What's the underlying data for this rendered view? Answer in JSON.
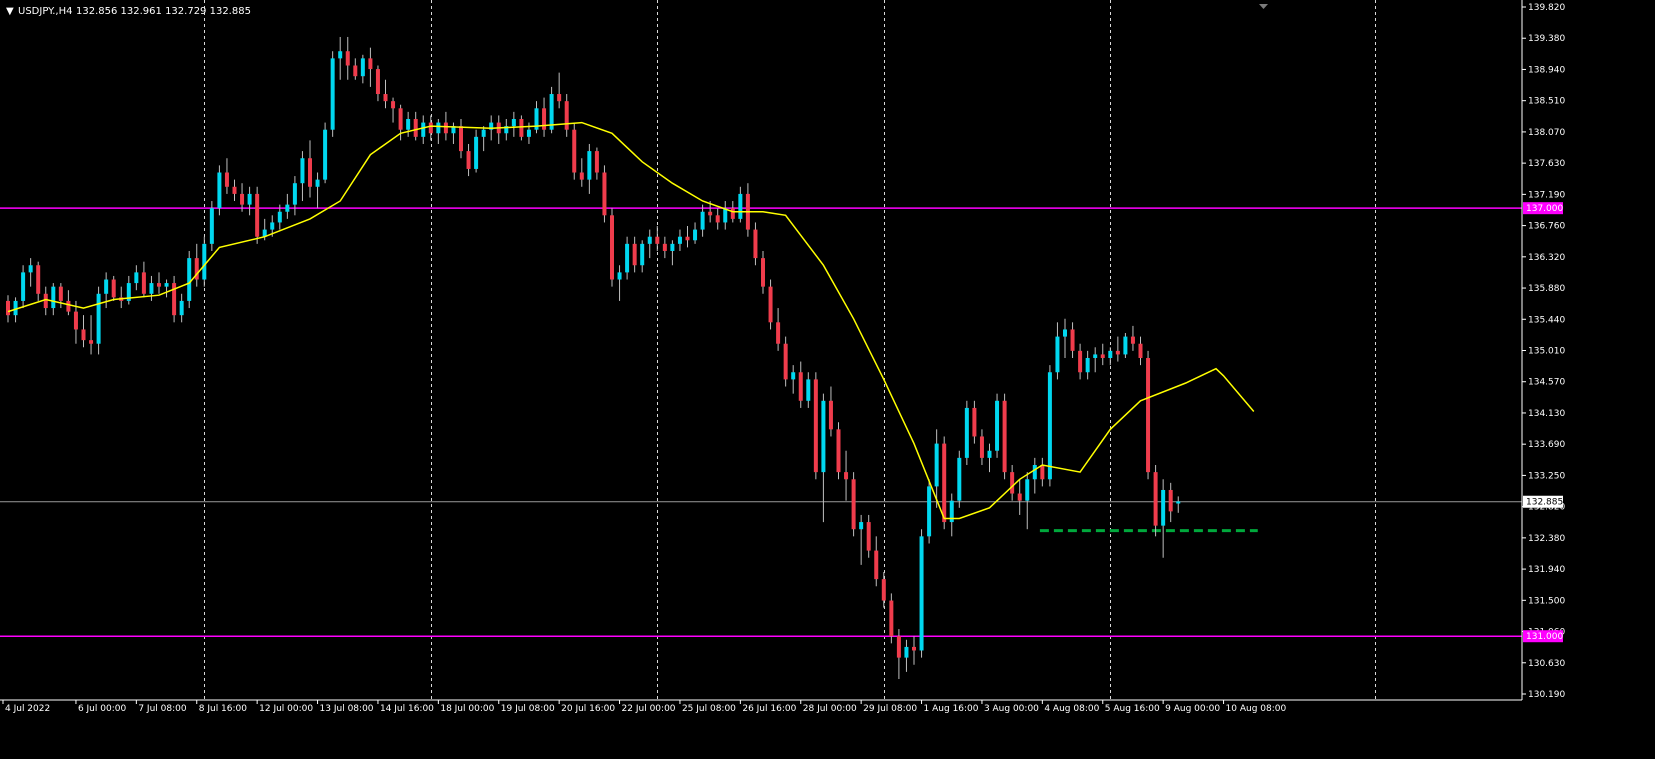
{
  "header": {
    "menu_glyph": "▼",
    "symbol_text": "USDJPY.,H4",
    "ohlc_text": "132.856 132.961 132.729 132.885"
  },
  "colors": {
    "background": "#000000",
    "bull": "#00D8F0",
    "bear": "#F03C4C",
    "wick": "#BFBFBF",
    "ma": "#FFFF00",
    "level": "#FF00FF",
    "support": "#00A83C",
    "price_line": "#9A9A9A",
    "grid": "#FFFFFF"
  },
  "chart_data": {
    "type": "candlestick",
    "symbol": "USDJPY.",
    "timeframe": "H4",
    "ylim": [
      130.19,
      139.82
    ],
    "y_ticks": [
      "139.820",
      "139.380",
      "138.940",
      "138.510",
      "138.070",
      "137.630",
      "137.190",
      "136.760",
      "136.320",
      "135.880",
      "135.440",
      "135.010",
      "134.570",
      "134.130",
      "133.690",
      "133.250",
      "132.820",
      "132.380",
      "131.940",
      "131.500",
      "131.060",
      "130.630",
      "130.190"
    ],
    "x_ticks": [
      {
        "label": "4 Jul 2022",
        "bar": 0
      },
      {
        "label": "6 Jul 00:00",
        "bar": 9
      },
      {
        "label": "7 Jul 08:00",
        "bar": 17
      },
      {
        "label": "8 Jul 16:00",
        "bar": 25
      },
      {
        "label": "12 Jul 00:00",
        "bar": 33
      },
      {
        "label": "13 Jul 08:00",
        "bar": 41
      },
      {
        "label": "14 Jul 16:00",
        "bar": 49
      },
      {
        "label": "18 Jul 00:00",
        "bar": 57
      },
      {
        "label": "19 Jul 08:00",
        "bar": 65
      },
      {
        "label": "20 Jul 16:00",
        "bar": 73
      },
      {
        "label": "22 Jul 00:00",
        "bar": 81
      },
      {
        "label": "25 Jul 08:00",
        "bar": 89
      },
      {
        "label": "26 Jul 16:00",
        "bar": 97
      },
      {
        "label": "28 Jul 00:00",
        "bar": 105
      },
      {
        "label": "29 Jul 08:00",
        "bar": 113
      },
      {
        "label": "1 Aug 16:00",
        "bar": 121
      },
      {
        "label": "3 Aug 00:00",
        "bar": 129
      },
      {
        "label": "4 Aug 08:00",
        "bar": 137
      },
      {
        "label": "5 Aug 16:00",
        "bar": 145
      },
      {
        "label": "9 Aug 00:00",
        "bar": 153
      },
      {
        "label": "10 Aug 08:00",
        "bar": 161
      }
    ],
    "vertical_gridline_bars": [
      26,
      56,
      86,
      116,
      146,
      181
    ],
    "horizontal_levels": [
      {
        "price": 137.0,
        "label": "137.000"
      },
      {
        "price": 131.0,
        "label": "131.000"
      }
    ],
    "current_price": {
      "price": 132.885,
      "label": "132.885"
    },
    "support_dashed": {
      "price": 132.48,
      "from_bar": 138,
      "to_bar": 165
    },
    "moving_average": [
      [
        0,
        135.55
      ],
      [
        5,
        135.72
      ],
      [
        10,
        135.6
      ],
      [
        14,
        135.72
      ],
      [
        20,
        135.78
      ],
      [
        24,
        135.95
      ],
      [
        28,
        136.45
      ],
      [
        34,
        136.6
      ],
      [
        40,
        136.85
      ],
      [
        44,
        137.1
      ],
      [
        48,
        137.75
      ],
      [
        52,
        138.05
      ],
      [
        56,
        138.15
      ],
      [
        64,
        138.12
      ],
      [
        70,
        138.15
      ],
      [
        76,
        138.2
      ],
      [
        80,
        138.05
      ],
      [
        84,
        137.65
      ],
      [
        88,
        137.35
      ],
      [
        92,
        137.1
      ],
      [
        96,
        136.95
      ],
      [
        100,
        136.95
      ],
      [
        103,
        136.9
      ],
      [
        108,
        136.2
      ],
      [
        112,
        135.45
      ],
      [
        116,
        134.6
      ],
      [
        120,
        133.7
      ],
      [
        124,
        132.65
      ],
      [
        126,
        132.65
      ],
      [
        130,
        132.8
      ],
      [
        134,
        133.2
      ],
      [
        137,
        133.4
      ],
      [
        142,
        133.3
      ],
      [
        146,
        133.9
      ],
      [
        150,
        134.3
      ],
      [
        156,
        134.55
      ],
      [
        160,
        134.75
      ],
      [
        161,
        134.65
      ],
      [
        165,
        134.15
      ]
    ],
    "ohlc": [
      [
        0,
        135.7,
        135.78,
        135.4,
        135.5
      ],
      [
        1,
        135.5,
        135.75,
        135.4,
        135.7
      ],
      [
        2,
        135.7,
        136.2,
        135.6,
        136.1
      ],
      [
        3,
        136.1,
        136.3,
        135.9,
        136.2
      ],
      [
        4,
        136.2,
        136.25,
        135.7,
        135.8
      ],
      [
        5,
        135.8,
        135.9,
        135.5,
        135.6
      ],
      [
        6,
        135.6,
        135.95,
        135.5,
        135.9
      ],
      [
        7,
        135.9,
        135.95,
        135.6,
        135.7
      ],
      [
        8,
        135.7,
        135.85,
        135.5,
        135.55
      ],
      [
        9,
        135.55,
        135.7,
        135.1,
        135.3
      ],
      [
        10,
        135.3,
        135.5,
        135.05,
        135.15
      ],
      [
        11,
        135.15,
        135.5,
        134.95,
        135.1
      ],
      [
        12,
        135.1,
        135.9,
        134.95,
        135.8
      ],
      [
        13,
        135.8,
        136.1,
        135.6,
        136.0
      ],
      [
        14,
        136.0,
        136.05,
        135.7,
        135.75
      ],
      [
        15,
        135.75,
        135.9,
        135.6,
        135.7
      ],
      [
        16,
        135.7,
        136.05,
        135.65,
        135.95
      ],
      [
        17,
        135.95,
        136.2,
        135.85,
        136.1
      ],
      [
        18,
        136.1,
        136.25,
        135.75,
        135.8
      ],
      [
        19,
        135.8,
        136.05,
        135.7,
        135.95
      ],
      [
        20,
        135.95,
        136.1,
        135.8,
        135.9
      ],
      [
        21,
        135.9,
        136.0,
        135.75,
        135.95
      ],
      [
        22,
        135.95,
        136.05,
        135.4,
        135.5
      ],
      [
        23,
        135.5,
        135.8,
        135.4,
        135.7
      ],
      [
        24,
        135.7,
        136.4,
        135.6,
        136.3
      ],
      [
        25,
        136.3,
        136.5,
        135.9,
        136.0
      ],
      [
        26,
        136.0,
        136.6,
        135.9,
        136.5
      ],
      [
        27,
        136.5,
        137.1,
        136.4,
        137.0
      ],
      [
        28,
        137.0,
        137.6,
        136.9,
        137.5
      ],
      [
        29,
        137.5,
        137.7,
        137.2,
        137.3
      ],
      [
        30,
        137.3,
        137.4,
        137.1,
        137.2
      ],
      [
        31,
        137.2,
        137.35,
        136.95,
        137.05
      ],
      [
        32,
        137.05,
        137.3,
        136.9,
        137.2
      ],
      [
        33,
        137.2,
        137.3,
        136.5,
        136.6
      ],
      [
        34,
        136.6,
        136.85,
        136.55,
        136.7
      ],
      [
        35,
        136.7,
        136.9,
        136.6,
        136.8
      ],
      [
        36,
        136.8,
        137.05,
        136.7,
        136.95
      ],
      [
        37,
        136.95,
        137.2,
        136.85,
        137.05
      ],
      [
        38,
        137.05,
        137.45,
        136.9,
        137.35
      ],
      [
        39,
        137.35,
        137.8,
        137.1,
        137.7
      ],
      [
        40,
        137.7,
        137.95,
        137.15,
        137.3
      ],
      [
        41,
        137.3,
        137.5,
        137.0,
        137.4
      ],
      [
        42,
        137.4,
        138.2,
        137.35,
        138.1
      ],
      [
        43,
        138.1,
        139.2,
        138.0,
        139.1
      ],
      [
        44,
        139.1,
        139.4,
        138.8,
        139.2
      ],
      [
        45,
        139.2,
        139.4,
        138.8,
        139.0
      ],
      [
        46,
        139.0,
        139.1,
        138.8,
        138.85
      ],
      [
        47,
        138.85,
        139.15,
        138.75,
        139.1
      ],
      [
        48,
        139.1,
        139.25,
        138.7,
        138.95
      ],
      [
        49,
        138.95,
        139.0,
        138.5,
        138.6
      ],
      [
        50,
        138.6,
        138.8,
        138.4,
        138.5
      ],
      [
        51,
        138.5,
        138.55,
        138.2,
        138.4
      ],
      [
        52,
        138.4,
        138.45,
        137.95,
        138.1
      ],
      [
        53,
        138.1,
        138.35,
        138.0,
        138.25
      ],
      [
        54,
        138.25,
        138.35,
        137.95,
        138.0
      ],
      [
        55,
        138.0,
        138.3,
        137.9,
        138.2
      ],
      [
        56,
        138.2,
        138.3,
        137.95,
        138.05
      ],
      [
        57,
        138.05,
        138.25,
        137.9,
        138.2
      ],
      [
        58,
        138.2,
        138.35,
        137.95,
        138.05
      ],
      [
        59,
        138.05,
        138.2,
        137.9,
        138.15
      ],
      [
        60,
        138.15,
        138.25,
        137.7,
        137.8
      ],
      [
        61,
        137.8,
        137.9,
        137.45,
        137.55
      ],
      [
        62,
        137.55,
        138.1,
        137.5,
        138.0
      ],
      [
        63,
        138.0,
        138.15,
        137.8,
        138.1
      ],
      [
        64,
        138.1,
        138.3,
        137.95,
        138.2
      ],
      [
        65,
        138.2,
        138.3,
        137.9,
        138.05
      ],
      [
        66,
        138.05,
        138.25,
        137.95,
        138.15
      ],
      [
        67,
        138.15,
        138.35,
        138.0,
        138.25
      ],
      [
        68,
        138.25,
        138.3,
        137.95,
        138.0
      ],
      [
        69,
        138.0,
        138.2,
        137.9,
        138.1
      ],
      [
        70,
        138.1,
        138.5,
        138.05,
        138.4
      ],
      [
        71,
        138.4,
        138.55,
        138.0,
        138.1
      ],
      [
        72,
        138.1,
        138.7,
        138.05,
        138.6
      ],
      [
        73,
        138.6,
        138.9,
        138.4,
        138.5
      ],
      [
        74,
        138.5,
        138.6,
        138.0,
        138.1
      ],
      [
        75,
        138.1,
        138.2,
        137.4,
        137.5
      ],
      [
        76,
        137.5,
        137.7,
        137.3,
        137.4
      ],
      [
        77,
        137.4,
        137.9,
        137.2,
        137.8
      ],
      [
        78,
        137.8,
        137.85,
        137.4,
        137.5
      ],
      [
        79,
        137.5,
        137.6,
        136.8,
        136.9
      ],
      [
        80,
        136.9,
        137.0,
        135.9,
        136.0
      ],
      [
        81,
        136.0,
        136.2,
        135.7,
        136.1
      ],
      [
        82,
        136.1,
        136.6,
        136.0,
        136.5
      ],
      [
        83,
        136.5,
        136.6,
        136.1,
        136.2
      ],
      [
        84,
        136.2,
        136.55,
        136.1,
        136.5
      ],
      [
        85,
        136.5,
        136.7,
        136.3,
        136.6
      ],
      [
        86,
        136.6,
        136.75,
        136.4,
        136.5
      ],
      [
        87,
        136.5,
        136.6,
        136.3,
        136.4
      ],
      [
        88,
        136.4,
        136.55,
        136.2,
        136.5
      ],
      [
        89,
        136.5,
        136.7,
        136.4,
        136.6
      ],
      [
        90,
        136.6,
        136.75,
        136.45,
        136.55
      ],
      [
        91,
        136.55,
        136.8,
        136.5,
        136.7
      ],
      [
        92,
        136.7,
        137.05,
        136.6,
        136.95
      ],
      [
        93,
        136.95,
        137.1,
        136.8,
        136.9
      ],
      [
        94,
        136.9,
        137.0,
        136.7,
        136.8
      ],
      [
        95,
        136.8,
        137.1,
        136.7,
        137.0
      ],
      [
        96,
        137.0,
        137.1,
        136.8,
        136.85
      ],
      [
        97,
        136.85,
        137.3,
        136.8,
        137.2
      ],
      [
        98,
        137.2,
        137.35,
        136.6,
        136.7
      ],
      [
        99,
        136.7,
        136.8,
        136.2,
        136.3
      ],
      [
        100,
        136.3,
        136.4,
        135.8,
        135.9
      ],
      [
        101,
        135.9,
        136.0,
        135.3,
        135.4
      ],
      [
        102,
        135.4,
        135.6,
        135.0,
        135.1
      ],
      [
        103,
        135.1,
        135.2,
        134.5,
        134.6
      ],
      [
        104,
        134.6,
        134.8,
        134.4,
        134.7
      ],
      [
        105,
        134.7,
        134.85,
        134.2,
        134.3
      ],
      [
        106,
        134.3,
        134.7,
        134.2,
        134.6
      ],
      [
        107,
        134.6,
        134.7,
        133.2,
        133.3
      ],
      [
        108,
        133.3,
        134.4,
        132.6,
        134.3
      ],
      [
        109,
        134.3,
        134.5,
        133.8,
        133.9
      ],
      [
        110,
        133.9,
        134.0,
        133.2,
        133.3
      ],
      [
        111,
        133.3,
        133.6,
        132.9,
        133.2
      ],
      [
        112,
        133.2,
        133.3,
        132.4,
        132.5
      ],
      [
        113,
        132.5,
        132.7,
        132.0,
        132.6
      ],
      [
        114,
        132.6,
        132.7,
        132.1,
        132.2
      ],
      [
        115,
        132.2,
        132.4,
        131.7,
        131.8
      ],
      [
        116,
        131.8,
        131.9,
        131.4,
        131.5
      ],
      [
        117,
        131.5,
        131.6,
        130.9,
        131.0
      ],
      [
        118,
        131.0,
        131.1,
        130.4,
        130.7
      ],
      [
        119,
        130.7,
        130.95,
        130.5,
        130.85
      ],
      [
        120,
        130.85,
        131.0,
        130.6,
        130.8
      ],
      [
        121,
        130.8,
        132.5,
        130.7,
        132.4
      ],
      [
        122,
        132.4,
        133.2,
        132.3,
        133.1
      ],
      [
        123,
        133.1,
        133.9,
        132.8,
        133.7
      ],
      [
        124,
        133.7,
        133.8,
        132.5,
        132.6
      ],
      [
        125,
        132.6,
        133.0,
        132.4,
        132.9
      ],
      [
        126,
        132.9,
        133.6,
        132.8,
        133.5
      ],
      [
        127,
        133.5,
        134.3,
        133.4,
        134.2
      ],
      [
        128,
        134.2,
        134.3,
        133.7,
        133.8
      ],
      [
        129,
        133.8,
        133.9,
        133.4,
        133.5
      ],
      [
        130,
        133.5,
        133.7,
        133.3,
        133.6
      ],
      [
        131,
        133.6,
        134.4,
        133.5,
        134.3
      ],
      [
        132,
        134.3,
        134.4,
        133.2,
        133.3
      ],
      [
        133,
        133.3,
        133.4,
        132.9,
        133.0
      ],
      [
        134,
        133.0,
        133.2,
        132.7,
        132.9
      ],
      [
        135,
        132.9,
        133.3,
        132.5,
        133.2
      ],
      [
        136,
        133.2,
        133.5,
        133.0,
        133.4
      ],
      [
        137,
        133.4,
        133.5,
        133.1,
        133.2
      ],
      [
        138,
        133.2,
        134.8,
        133.1,
        134.7
      ],
      [
        139,
        134.7,
        135.4,
        134.6,
        135.2
      ],
      [
        140,
        135.2,
        135.45,
        134.9,
        135.3
      ],
      [
        141,
        135.3,
        135.4,
        134.9,
        135.0
      ],
      [
        142,
        135.0,
        135.1,
        134.6,
        134.7
      ],
      [
        143,
        134.7,
        135.0,
        134.6,
        134.9
      ],
      [
        144,
        134.9,
        135.05,
        134.7,
        134.95
      ],
      [
        145,
        134.95,
        135.1,
        134.8,
        134.9
      ],
      [
        146,
        134.9,
        135.05,
        134.8,
        135.0
      ],
      [
        147,
        135.0,
        135.2,
        134.85,
        134.95
      ],
      [
        148,
        134.95,
        135.25,
        134.9,
        135.2
      ],
      [
        149,
        135.2,
        135.35,
        135.0,
        135.1
      ],
      [
        150,
        135.1,
        135.2,
        134.8,
        134.9
      ],
      [
        151,
        134.9,
        135.0,
        133.2,
        133.3
      ],
      [
        152,
        133.3,
        133.4,
        132.4,
        132.55
      ],
      [
        153,
        132.55,
        133.2,
        132.1,
        133.05
      ],
      [
        154,
        133.05,
        133.15,
        132.6,
        132.75
      ],
      [
        155,
        132.86,
        132.96,
        132.73,
        132.89
      ]
    ]
  },
  "price_axis": {
    "level_labels": [
      "137.000",
      "131.000"
    ],
    "current_label": "132.885"
  }
}
